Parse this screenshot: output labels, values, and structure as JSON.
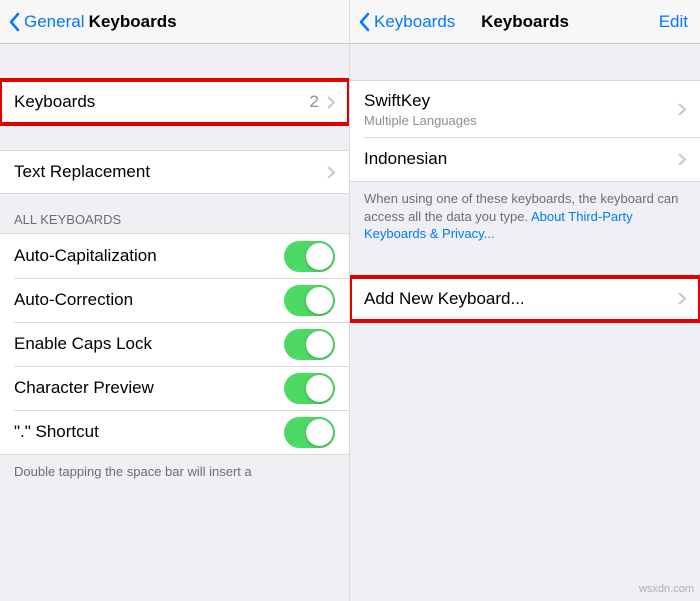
{
  "left": {
    "nav": {
      "back": "General",
      "title": "Keyboards"
    },
    "keyboards_row": {
      "label": "Keyboards",
      "count": "2"
    },
    "text_replacement": {
      "label": "Text Replacement"
    },
    "group_header": "ALL KEYBOARDS",
    "toggles": [
      {
        "label": "Auto-Capitalization"
      },
      {
        "label": "Auto-Correction"
      },
      {
        "label": "Enable Caps Lock"
      },
      {
        "label": "Character Preview"
      },
      {
        "label": "\".\" Shortcut"
      }
    ],
    "footer": "Double tapping the space bar will insert a"
  },
  "right": {
    "nav": {
      "back": "Keyboards",
      "title": "Keyboards",
      "edit": "Edit"
    },
    "rows": [
      {
        "label": "SwiftKey",
        "sub": "Multiple Languages"
      },
      {
        "label": "Indonesian"
      }
    ],
    "footer_text": "When using one of these keyboards, the keyboard can access all the data you type. ",
    "footer_link": "About Third-Party Keyboards & Privacy...",
    "add_row": {
      "label": "Add New Keyboard..."
    }
  },
  "watermark": "wsxdn.com"
}
